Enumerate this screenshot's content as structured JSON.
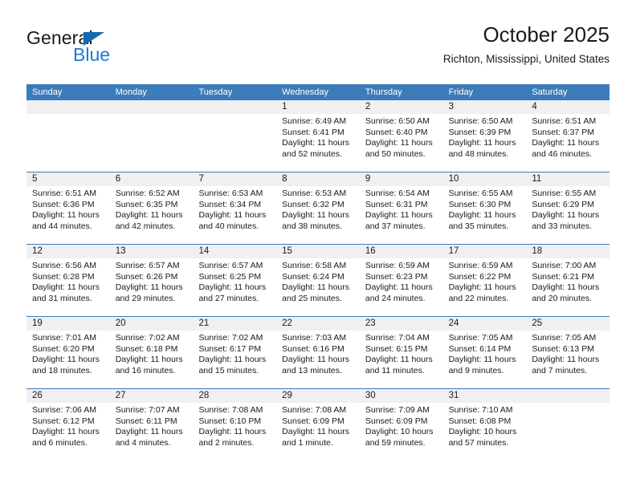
{
  "brand": {
    "name_top": "General",
    "name_bottom": "Blue",
    "accent_color": "#1c7ad1",
    "triangle_color": "#1668b3"
  },
  "header": {
    "title": "October 2025",
    "subtitle": "Richton, Mississippi, United States"
  },
  "calendar": {
    "header_color": "#3b7cb9",
    "day_band_color": "#f0f0f0",
    "weekdays": [
      "Sunday",
      "Monday",
      "Tuesday",
      "Wednesday",
      "Thursday",
      "Friday",
      "Saturday"
    ],
    "weeks": [
      [
        {
          "day": "",
          "sunrise": "",
          "sunset": "",
          "daylight1": "",
          "daylight2": "",
          "empty": true
        },
        {
          "day": "",
          "sunrise": "",
          "sunset": "",
          "daylight1": "",
          "daylight2": "",
          "empty": true
        },
        {
          "day": "",
          "sunrise": "",
          "sunset": "",
          "daylight1": "",
          "daylight2": "",
          "empty": true
        },
        {
          "day": "1",
          "sunrise": "Sunrise: 6:49 AM",
          "sunset": "Sunset: 6:41 PM",
          "daylight1": "Daylight: 11 hours",
          "daylight2": "and 52 minutes."
        },
        {
          "day": "2",
          "sunrise": "Sunrise: 6:50 AM",
          "sunset": "Sunset: 6:40 PM",
          "daylight1": "Daylight: 11 hours",
          "daylight2": "and 50 minutes."
        },
        {
          "day": "3",
          "sunrise": "Sunrise: 6:50 AM",
          "sunset": "Sunset: 6:39 PM",
          "daylight1": "Daylight: 11 hours",
          "daylight2": "and 48 minutes."
        },
        {
          "day": "4",
          "sunrise": "Sunrise: 6:51 AM",
          "sunset": "Sunset: 6:37 PM",
          "daylight1": "Daylight: 11 hours",
          "daylight2": "and 46 minutes."
        }
      ],
      [
        {
          "day": "5",
          "sunrise": "Sunrise: 6:51 AM",
          "sunset": "Sunset: 6:36 PM",
          "daylight1": "Daylight: 11 hours",
          "daylight2": "and 44 minutes."
        },
        {
          "day": "6",
          "sunrise": "Sunrise: 6:52 AM",
          "sunset": "Sunset: 6:35 PM",
          "daylight1": "Daylight: 11 hours",
          "daylight2": "and 42 minutes."
        },
        {
          "day": "7",
          "sunrise": "Sunrise: 6:53 AM",
          "sunset": "Sunset: 6:34 PM",
          "daylight1": "Daylight: 11 hours",
          "daylight2": "and 40 minutes."
        },
        {
          "day": "8",
          "sunrise": "Sunrise: 6:53 AM",
          "sunset": "Sunset: 6:32 PM",
          "daylight1": "Daylight: 11 hours",
          "daylight2": "and 38 minutes."
        },
        {
          "day": "9",
          "sunrise": "Sunrise: 6:54 AM",
          "sunset": "Sunset: 6:31 PM",
          "daylight1": "Daylight: 11 hours",
          "daylight2": "and 37 minutes."
        },
        {
          "day": "10",
          "sunrise": "Sunrise: 6:55 AM",
          "sunset": "Sunset: 6:30 PM",
          "daylight1": "Daylight: 11 hours",
          "daylight2": "and 35 minutes."
        },
        {
          "day": "11",
          "sunrise": "Sunrise: 6:55 AM",
          "sunset": "Sunset: 6:29 PM",
          "daylight1": "Daylight: 11 hours",
          "daylight2": "and 33 minutes."
        }
      ],
      [
        {
          "day": "12",
          "sunrise": "Sunrise: 6:56 AM",
          "sunset": "Sunset: 6:28 PM",
          "daylight1": "Daylight: 11 hours",
          "daylight2": "and 31 minutes."
        },
        {
          "day": "13",
          "sunrise": "Sunrise: 6:57 AM",
          "sunset": "Sunset: 6:26 PM",
          "daylight1": "Daylight: 11 hours",
          "daylight2": "and 29 minutes."
        },
        {
          "day": "14",
          "sunrise": "Sunrise: 6:57 AM",
          "sunset": "Sunset: 6:25 PM",
          "daylight1": "Daylight: 11 hours",
          "daylight2": "and 27 minutes."
        },
        {
          "day": "15",
          "sunrise": "Sunrise: 6:58 AM",
          "sunset": "Sunset: 6:24 PM",
          "daylight1": "Daylight: 11 hours",
          "daylight2": "and 25 minutes."
        },
        {
          "day": "16",
          "sunrise": "Sunrise: 6:59 AM",
          "sunset": "Sunset: 6:23 PM",
          "daylight1": "Daylight: 11 hours",
          "daylight2": "and 24 minutes."
        },
        {
          "day": "17",
          "sunrise": "Sunrise: 6:59 AM",
          "sunset": "Sunset: 6:22 PM",
          "daylight1": "Daylight: 11 hours",
          "daylight2": "and 22 minutes."
        },
        {
          "day": "18",
          "sunrise": "Sunrise: 7:00 AM",
          "sunset": "Sunset: 6:21 PM",
          "daylight1": "Daylight: 11 hours",
          "daylight2": "and 20 minutes."
        }
      ],
      [
        {
          "day": "19",
          "sunrise": "Sunrise: 7:01 AM",
          "sunset": "Sunset: 6:20 PM",
          "daylight1": "Daylight: 11 hours",
          "daylight2": "and 18 minutes."
        },
        {
          "day": "20",
          "sunrise": "Sunrise: 7:02 AM",
          "sunset": "Sunset: 6:18 PM",
          "daylight1": "Daylight: 11 hours",
          "daylight2": "and 16 minutes."
        },
        {
          "day": "21",
          "sunrise": "Sunrise: 7:02 AM",
          "sunset": "Sunset: 6:17 PM",
          "daylight1": "Daylight: 11 hours",
          "daylight2": "and 15 minutes."
        },
        {
          "day": "22",
          "sunrise": "Sunrise: 7:03 AM",
          "sunset": "Sunset: 6:16 PM",
          "daylight1": "Daylight: 11 hours",
          "daylight2": "and 13 minutes."
        },
        {
          "day": "23",
          "sunrise": "Sunrise: 7:04 AM",
          "sunset": "Sunset: 6:15 PM",
          "daylight1": "Daylight: 11 hours",
          "daylight2": "and 11 minutes."
        },
        {
          "day": "24",
          "sunrise": "Sunrise: 7:05 AM",
          "sunset": "Sunset: 6:14 PM",
          "daylight1": "Daylight: 11 hours",
          "daylight2": "and 9 minutes."
        },
        {
          "day": "25",
          "sunrise": "Sunrise: 7:05 AM",
          "sunset": "Sunset: 6:13 PM",
          "daylight1": "Daylight: 11 hours",
          "daylight2": "and 7 minutes."
        }
      ],
      [
        {
          "day": "26",
          "sunrise": "Sunrise: 7:06 AM",
          "sunset": "Sunset: 6:12 PM",
          "daylight1": "Daylight: 11 hours",
          "daylight2": "and 6 minutes."
        },
        {
          "day": "27",
          "sunrise": "Sunrise: 7:07 AM",
          "sunset": "Sunset: 6:11 PM",
          "daylight1": "Daylight: 11 hours",
          "daylight2": "and 4 minutes."
        },
        {
          "day": "28",
          "sunrise": "Sunrise: 7:08 AM",
          "sunset": "Sunset: 6:10 PM",
          "daylight1": "Daylight: 11 hours",
          "daylight2": "and 2 minutes."
        },
        {
          "day": "29",
          "sunrise": "Sunrise: 7:08 AM",
          "sunset": "Sunset: 6:09 PM",
          "daylight1": "Daylight: 11 hours",
          "daylight2": "and 1 minute."
        },
        {
          "day": "30",
          "sunrise": "Sunrise: 7:09 AM",
          "sunset": "Sunset: 6:09 PM",
          "daylight1": "Daylight: 10 hours",
          "daylight2": "and 59 minutes."
        },
        {
          "day": "31",
          "sunrise": "Sunrise: 7:10 AM",
          "sunset": "Sunset: 6:08 PM",
          "daylight1": "Daylight: 10 hours",
          "daylight2": "and 57 minutes."
        },
        {
          "day": "",
          "sunrise": "",
          "sunset": "",
          "daylight1": "",
          "daylight2": "",
          "empty": true
        }
      ]
    ]
  }
}
